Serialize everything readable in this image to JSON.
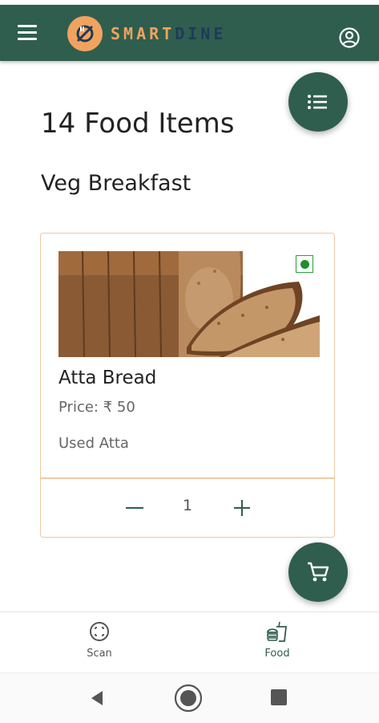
{
  "app": {
    "logo_part1": "SMART",
    "logo_part2": "DINE",
    "brand_color": "#2f5e4e",
    "accent_color": "#f0a35e"
  },
  "page": {
    "title": "14 Food Items",
    "section": "Veg Breakfast"
  },
  "item": {
    "name": "Atta Bread",
    "price": "Price: ₹ 50",
    "description": "Used Atta",
    "veg_indicator": "veg-dot-icon",
    "quantity": "1"
  },
  "nav": {
    "scan_label": "Scan",
    "food_label": "Food"
  },
  "icons": {
    "menu": "hamburger-menu-icon",
    "profile": "account-circle-icon",
    "list": "list-icon",
    "cart": "shopping-cart-icon",
    "scan": "scan-icon",
    "food": "fastfood-icon"
  }
}
